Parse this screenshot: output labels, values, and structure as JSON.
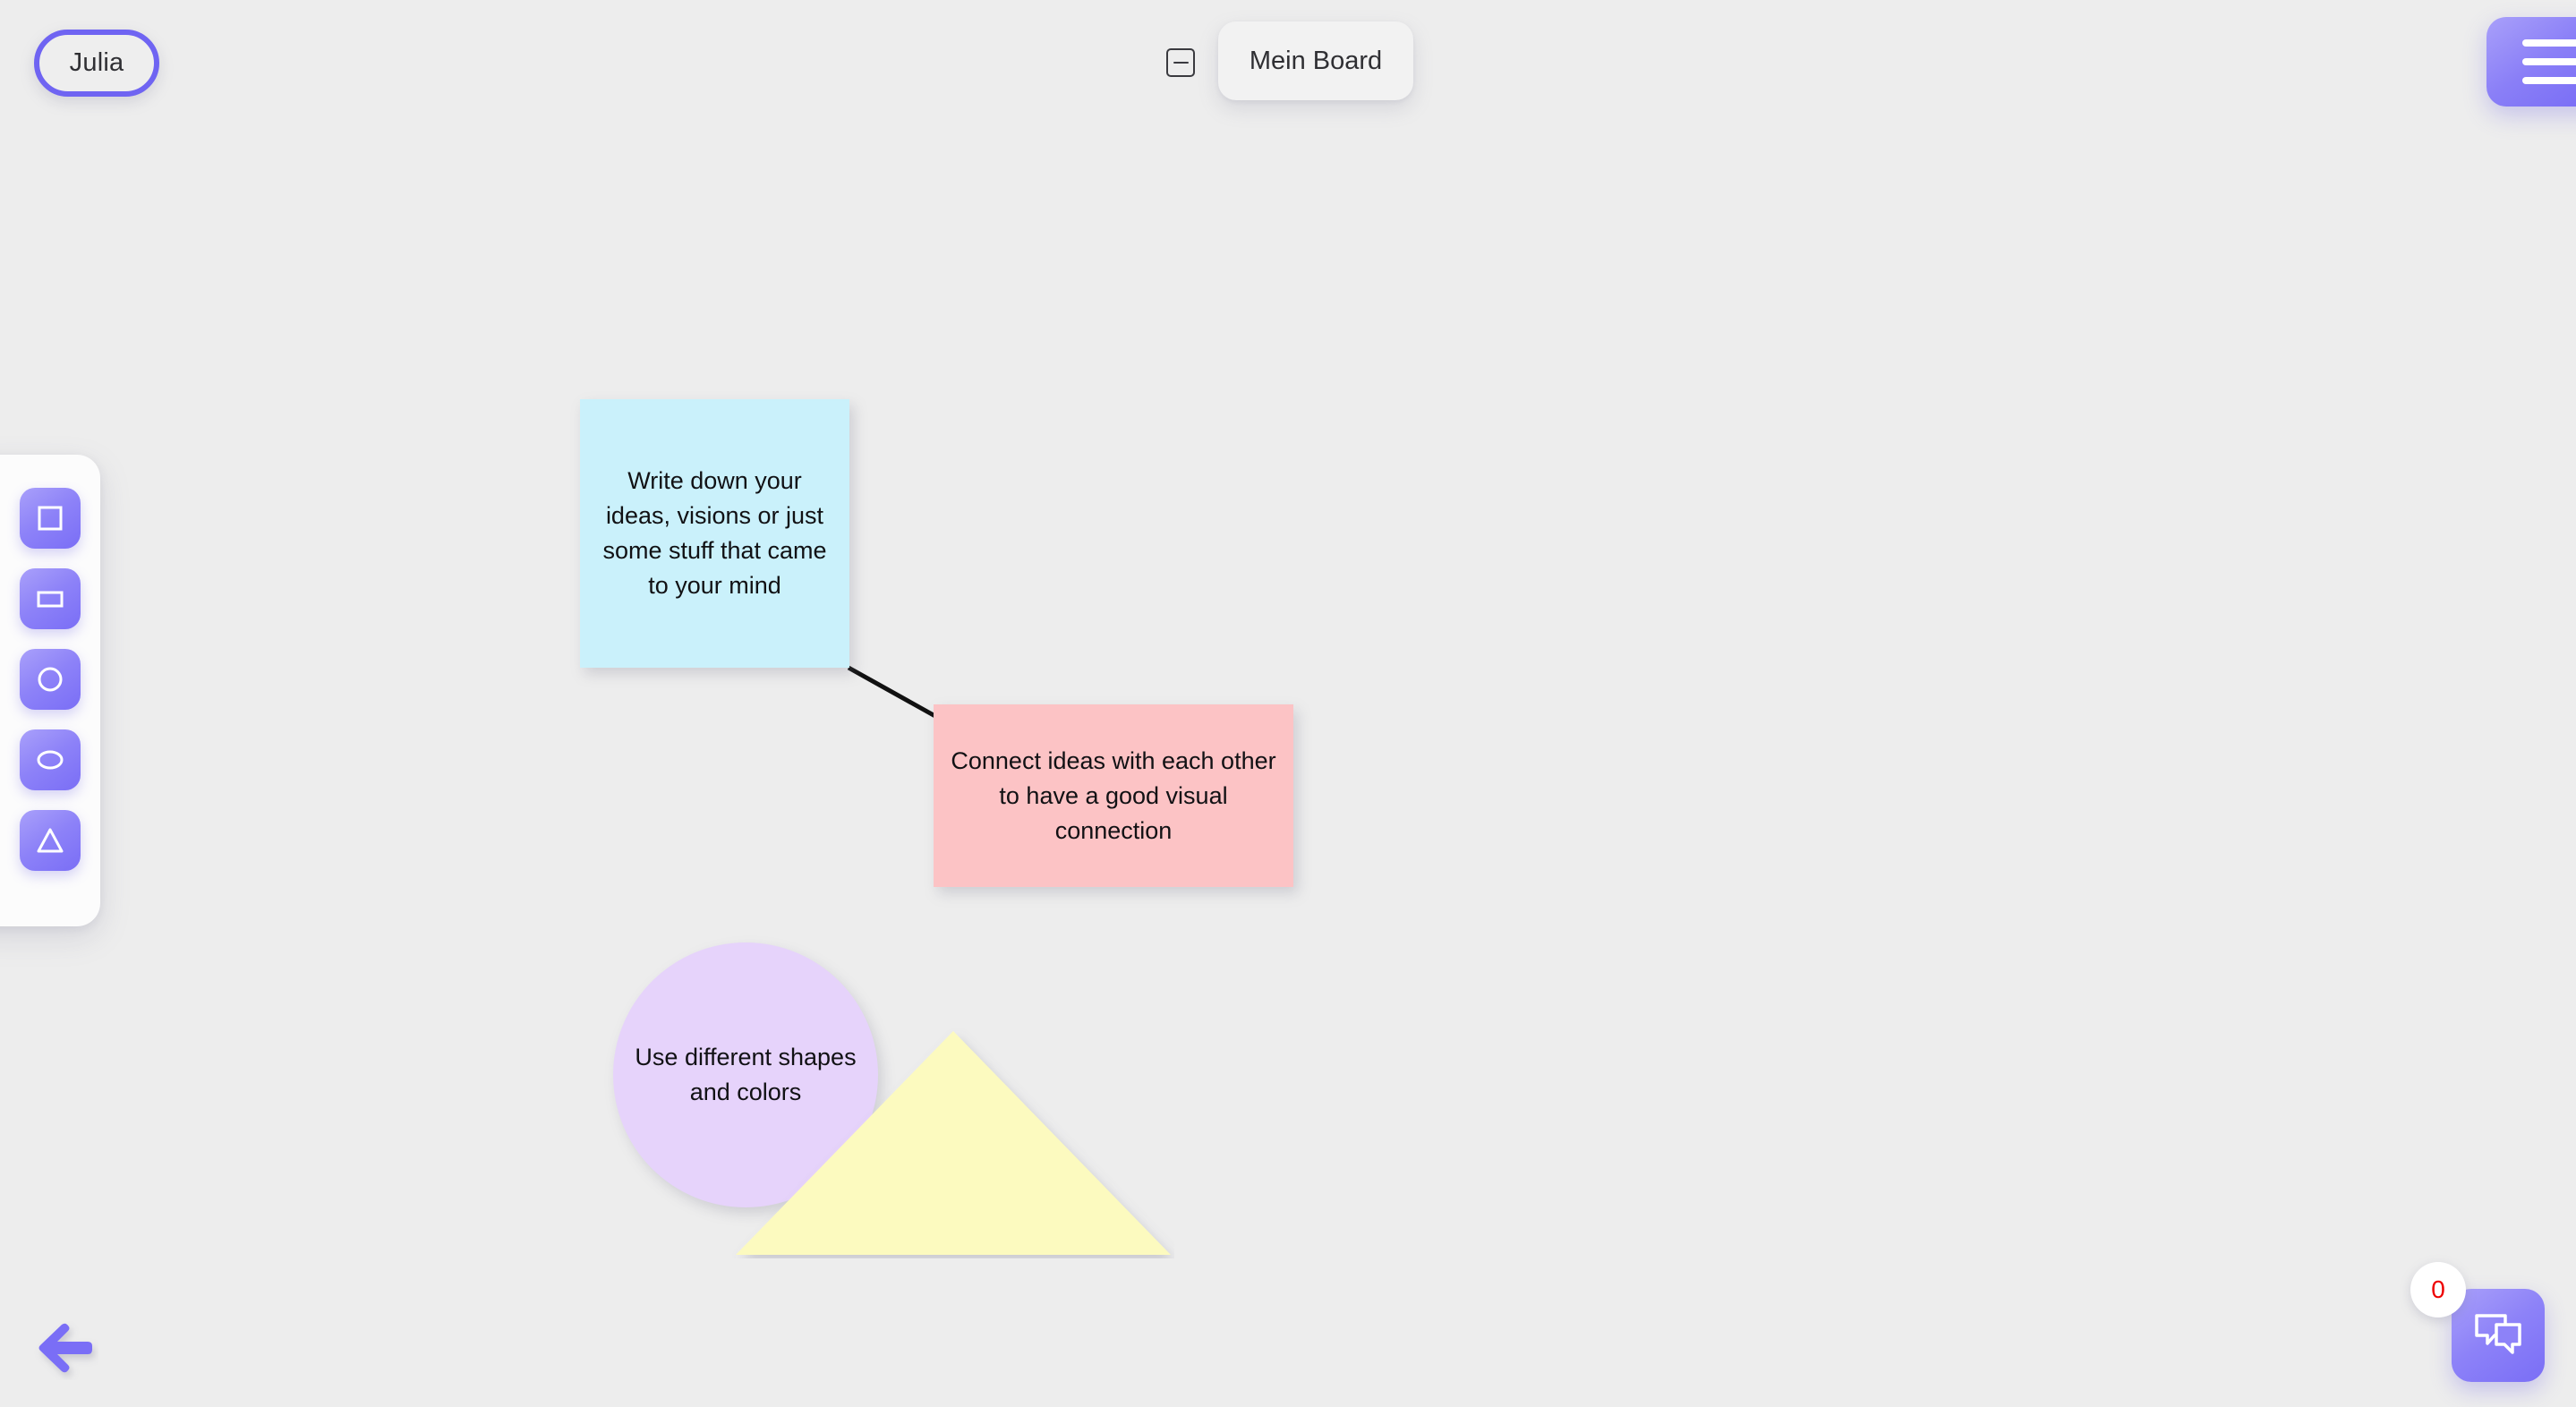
{
  "app": {
    "background_color": "#ededed",
    "accent_color": "#7a6ef6",
    "badge_color": "#ee0000"
  },
  "topbar": {
    "user_name": "Julia",
    "collapse_icon": "minus-square-icon",
    "board_title": "Mein Board",
    "menu_icon": "hamburger-menu-icon"
  },
  "toolbar": {
    "tools": [
      {
        "label": "Square",
        "icon": "square-icon"
      },
      {
        "label": "Rectangle",
        "icon": "rectangle-icon"
      },
      {
        "label": "Circle",
        "icon": "circle-icon"
      },
      {
        "label": "Ellipse",
        "icon": "ellipse-icon"
      },
      {
        "label": "Triangle",
        "icon": "triangle-icon"
      }
    ]
  },
  "canvas": {
    "objects": [
      {
        "type": "sticky-note",
        "shape": "square",
        "text": "Write down your ideas, visions or just some stuff that came to your mind",
        "color": "#caf1fb"
      },
      {
        "type": "sticky-note",
        "shape": "rectangle",
        "text": "Connect ideas with each other to have a good visual connection",
        "color": "#fcc3c5"
      },
      {
        "type": "shape",
        "shape": "circle",
        "text": "Use different shapes and colors",
        "color": "#e6d3fb"
      },
      {
        "type": "shape",
        "shape": "triangle",
        "text": "",
        "color": "#fcfabf"
      }
    ],
    "connector": {
      "from": "sticky-note-blue",
      "to": "sticky-note-pink",
      "color": "#111111"
    }
  },
  "footer": {
    "back_icon": "arrow-left-icon",
    "chat_icon": "chat-bubbles-icon",
    "chat_unread_count": "0"
  }
}
